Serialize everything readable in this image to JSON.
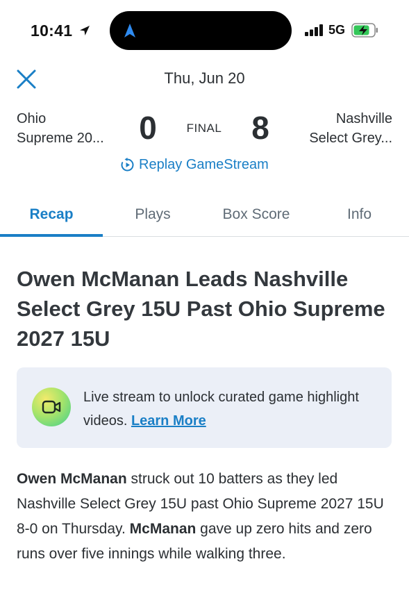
{
  "status_bar": {
    "time": "10:41",
    "network": "5G",
    "icons": [
      "location-arrow-icon",
      "navigation-icon",
      "signal-icon",
      "battery-charging-icon"
    ]
  },
  "header": {
    "date": "Thu, Jun 20",
    "close_icon": "close-icon",
    "home_team": {
      "line1": "Ohio",
      "line2": "Supreme 20...",
      "score": "0"
    },
    "away_team": {
      "line1": "Nashville",
      "line2": "Select Grey...",
      "score": "8"
    },
    "status": "FINAL",
    "replay_label": "Replay GameStream",
    "replay_icon": "replay-icon"
  },
  "tabs": [
    {
      "label": "Recap",
      "active": true
    },
    {
      "label": "Plays",
      "active": false
    },
    {
      "label": "Box Score",
      "active": false
    },
    {
      "label": "Info",
      "active": false
    }
  ],
  "article": {
    "headline": "Owen McManan Leads Nashville Select Grey 15U Past Ohio Supreme 2027 15U",
    "promo": {
      "icon": "video-camera-icon",
      "text": "Live stream to unlock curated game highlight videos.",
      "link": "Learn More"
    },
    "body": {
      "p1_name": "Owen McManan",
      "p1_text": " struck out 10 batters as they led Nashville Select Grey 15U past Ohio Supreme 2027 15U 8-0 on Thursday. ",
      "p2_name": "McManan",
      "p2_text": " gave up zero hits and zero runs over five innings while walking three."
    }
  },
  "colors": {
    "accent": "#1a7fc6",
    "text": "#2b2f33",
    "promo_bg": "#ebeff7",
    "battery_green": "#34c759"
  }
}
